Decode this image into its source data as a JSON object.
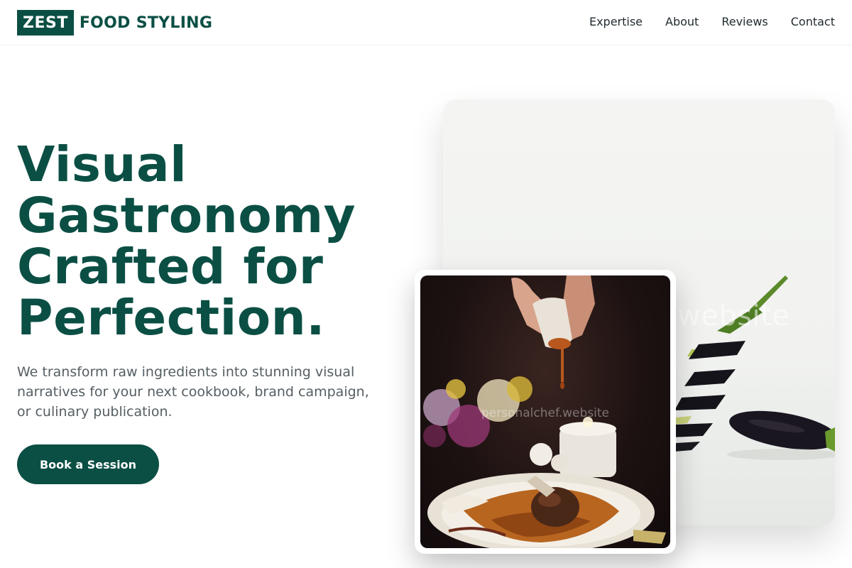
{
  "brand": {
    "logo_mark": "ZEST",
    "logo_text": "FOOD STYLING"
  },
  "nav": {
    "items": [
      {
        "label": "Expertise"
      },
      {
        "label": "About"
      },
      {
        "label": "Reviews"
      },
      {
        "label": "Contact"
      }
    ]
  },
  "hero": {
    "title": "Visual Gastronomy Crafted for Perfection.",
    "subtitle": "We transform raw ingredients into stunning visual narratives for your next cookbook, brand campaign, or culinary publication.",
    "cta_label": "Book a Session"
  },
  "images": {
    "back_watermark": "website",
    "front_watermark": "personalchef.website"
  },
  "colors": {
    "brand": "#0b4f44",
    "text": "#1f2a2e",
    "muted": "#555e63"
  }
}
